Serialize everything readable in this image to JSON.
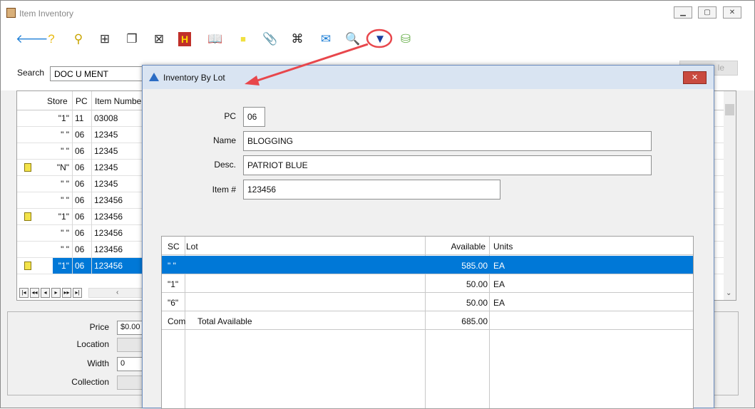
{
  "window": {
    "title": "Item Inventory"
  },
  "toolbar": {
    "buttons": [
      {
        "name": "back-arrow-icon",
        "glyph": "🡐",
        "color": "#1e7fd6"
      },
      {
        "name": "help-icon",
        "glyph": "?",
        "color": "#e8b90e"
      },
      {
        "name": "pin-icon",
        "glyph": "⚲",
        "color": "#c8a400"
      },
      {
        "name": "add-document-icon",
        "glyph": "⊞",
        "color": "#333"
      },
      {
        "name": "copy-document-icon",
        "glyph": "❐",
        "color": "#333"
      },
      {
        "name": "delete-document-icon",
        "glyph": "⊠",
        "color": "#333"
      },
      {
        "name": "history-icon",
        "glyph": "H",
        "color": "#ffd800"
      },
      {
        "name": "book-icon",
        "glyph": "📖",
        "color": "#333"
      },
      {
        "name": "note-icon",
        "glyph": "■",
        "color": "#f0e040"
      },
      {
        "name": "paperclip-icon",
        "glyph": "📎",
        "color": "#555"
      },
      {
        "name": "binoculars-icon",
        "glyph": "⌘",
        "color": "#222"
      },
      {
        "name": "email-icon",
        "glyph": "✉",
        "color": "#1e7fd6"
      },
      {
        "name": "magnifier-icon",
        "glyph": "🔍",
        "color": "#1e7fd6"
      },
      {
        "name": "dropdown-icon",
        "glyph": "▼",
        "color": "#1a3fa0"
      },
      {
        "name": "database-icon",
        "glyph": "⛁",
        "color": "#6ab04c"
      }
    ]
  },
  "search": {
    "label": "Search",
    "value": "DOC U MENT"
  },
  "right_button": {
    "label": "le"
  },
  "grid": {
    "columns": [
      "Store",
      "PC",
      "Item Number"
    ],
    "rows": [
      {
        "store": "\"1\"",
        "pc": "11",
        "item": "03008",
        "note": false,
        "selected": false
      },
      {
        "store": "\" \"",
        "pc": "06",
        "item": "12345",
        "note": false,
        "selected": false
      },
      {
        "store": "\" \"",
        "pc": "06",
        "item": "12345",
        "note": false,
        "selected": false
      },
      {
        "store": "\"N\"",
        "pc": "06",
        "item": "12345",
        "note": true,
        "selected": false
      },
      {
        "store": "\" \"",
        "pc": "06",
        "item": "12345",
        "note": false,
        "selected": false
      },
      {
        "store": "\" \"",
        "pc": "06",
        "item": "123456",
        "note": false,
        "selected": false
      },
      {
        "store": "\"1\"",
        "pc": "06",
        "item": "123456",
        "note": true,
        "selected": false
      },
      {
        "store": "\" \"",
        "pc": "06",
        "item": "123456",
        "note": false,
        "selected": false
      },
      {
        "store": "\" \"",
        "pc": "06",
        "item": "123456",
        "note": false,
        "selected": false
      },
      {
        "store": "\"1\"",
        "pc": "06",
        "item": "123456",
        "note": true,
        "selected": true
      }
    ]
  },
  "details": {
    "price_label": "Price",
    "price_value": "$0.00",
    "location_label": "Location",
    "width_label": "Width",
    "width_value": "0",
    "collection_label": "Collection"
  },
  "dialog": {
    "title": "Inventory By Lot",
    "close_label": "✕",
    "pc_label": "PC",
    "pc_value": "06",
    "name_label": "Name",
    "name_value": "BLOGGING",
    "desc_label": "Desc.",
    "desc_value": "PATRIOT BLUE",
    "item_label": "Item #",
    "item_value": "123456",
    "table": {
      "headers": {
        "sc": "SC",
        "lot": "Lot",
        "available": "Available",
        "units": "Units"
      },
      "rows": [
        {
          "sc": "\" \"",
          "lot": "",
          "available": "585.00",
          "units": "EA",
          "selected": true
        },
        {
          "sc": "\"1\"",
          "lot": "",
          "available": "50.00",
          "units": "EA",
          "selected": false
        },
        {
          "sc": "\"6\"",
          "lot": "",
          "available": "50.00",
          "units": "EA",
          "selected": false
        },
        {
          "sc": "Com",
          "lot": "Total Available",
          "available": "685.00",
          "units": "",
          "selected": false
        }
      ]
    }
  },
  "colors": {
    "selection": "#0078d7",
    "annotation": "#e8474c"
  }
}
